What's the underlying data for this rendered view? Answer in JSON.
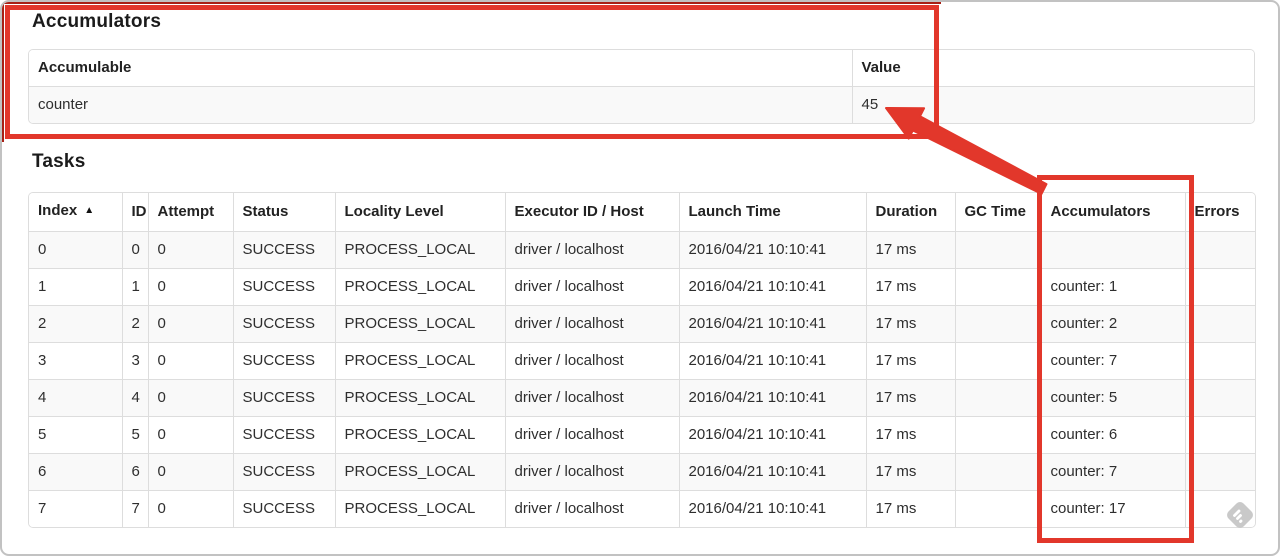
{
  "colors": {
    "annotation_red": "#e2372b",
    "annotation_dark_red": "#a82015",
    "row_stripe": "#f9f9f9",
    "table_border": "#dddddd",
    "watermark_gray": "#c9c9c9"
  },
  "icons": {
    "sort_ascending": "▲",
    "watermark": "diamond-annotation-badge"
  },
  "accumulators": {
    "title": "Accumulators",
    "headers": {
      "accumulable": "Accumulable",
      "value": "Value"
    },
    "row": {
      "accumulable": "counter",
      "value": "45"
    }
  },
  "tasks": {
    "title": "Tasks",
    "headers": {
      "index": "Index",
      "id": "ID",
      "attempt": "Attempt",
      "status": "Status",
      "locality": "Locality Level",
      "executor": "Executor ID / Host",
      "launch": "Launch Time",
      "duration": "Duration",
      "gc": "GC Time",
      "accumulators": "Accumulators",
      "errors": "Errors"
    },
    "rows": [
      {
        "index": "0",
        "id": "0",
        "attempt": "0",
        "status": "SUCCESS",
        "locality": "PROCESS_LOCAL",
        "executor": "driver / localhost",
        "launch": "2016/04/21 10:10:41",
        "duration": "17 ms",
        "gc": "",
        "accumulators": "",
        "errors": ""
      },
      {
        "index": "1",
        "id": "1",
        "attempt": "0",
        "status": "SUCCESS",
        "locality": "PROCESS_LOCAL",
        "executor": "driver / localhost",
        "launch": "2016/04/21 10:10:41",
        "duration": "17 ms",
        "gc": "",
        "accumulators": "counter: 1",
        "errors": ""
      },
      {
        "index": "2",
        "id": "2",
        "attempt": "0",
        "status": "SUCCESS",
        "locality": "PROCESS_LOCAL",
        "executor": "driver / localhost",
        "launch": "2016/04/21 10:10:41",
        "duration": "17 ms",
        "gc": "",
        "accumulators": "counter: 2",
        "errors": ""
      },
      {
        "index": "3",
        "id": "3",
        "attempt": "0",
        "status": "SUCCESS",
        "locality": "PROCESS_LOCAL",
        "executor": "driver / localhost",
        "launch": "2016/04/21 10:10:41",
        "duration": "17 ms",
        "gc": "",
        "accumulators": "counter: 7",
        "errors": ""
      },
      {
        "index": "4",
        "id": "4",
        "attempt": "0",
        "status": "SUCCESS",
        "locality": "PROCESS_LOCAL",
        "executor": "driver / localhost",
        "launch": "2016/04/21 10:10:41",
        "duration": "17 ms",
        "gc": "",
        "accumulators": "counter: 5",
        "errors": ""
      },
      {
        "index": "5",
        "id": "5",
        "attempt": "0",
        "status": "SUCCESS",
        "locality": "PROCESS_LOCAL",
        "executor": "driver / localhost",
        "launch": "2016/04/21 10:10:41",
        "duration": "17 ms",
        "gc": "",
        "accumulators": "counter: 6",
        "errors": ""
      },
      {
        "index": "6",
        "id": "6",
        "attempt": "0",
        "status": "SUCCESS",
        "locality": "PROCESS_LOCAL",
        "executor": "driver / localhost",
        "launch": "2016/04/21 10:10:41",
        "duration": "17 ms",
        "gc": "",
        "accumulators": "counter: 7",
        "errors": ""
      },
      {
        "index": "7",
        "id": "7",
        "attempt": "0",
        "status": "SUCCESS",
        "locality": "PROCESS_LOCAL",
        "executor": "driver / localhost",
        "launch": "2016/04/21 10:10:41",
        "duration": "17 ms",
        "gc": "",
        "accumulators": "counter: 17",
        "errors": ""
      }
    ]
  }
}
